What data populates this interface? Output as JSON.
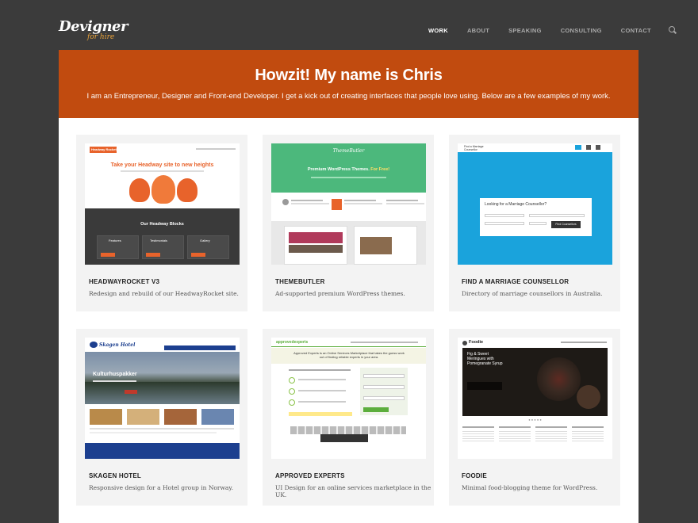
{
  "header": {
    "logo_main": "Devigner",
    "logo_sub": "for hire",
    "nav": [
      "WORK",
      "ABOUT",
      "SPEAKING",
      "CONSULTING",
      "CONTACT"
    ],
    "active_nav": "WORK"
  },
  "hero": {
    "title": "Howzit! My name is Chris",
    "subtitle": "I am an Entrepreneur, Designer and Front-end Developer. I get a kick out of creating interfaces that people love using. Below are a few examples of my work."
  },
  "projects": [
    {
      "title": "HEADWAYROCKET V3",
      "desc": "Redesign and rebuild of our HeadwayRocket site.",
      "thumb": {
        "headline": "Take your Headway site to new heights",
        "section": "Our Headway Blocks",
        "cols": [
          "Features",
          "Testimonials",
          "Gallery"
        ],
        "brand": "Headway Rocket"
      }
    },
    {
      "title": "THEMEBUTLER",
      "desc": "Ad-supported premium WordPress themes.",
      "thumb": {
        "brand": "ThemeButler",
        "headline": "Premium WordPress Themes.",
        "highlight": "For Free!"
      }
    },
    {
      "title": "FIND A MARRIAGE COUNSELLOR",
      "desc": "Directory of marriage counsellors in Australia.",
      "thumb": {
        "brand": "Find a Marriage Counsellor",
        "question": "Looking for a Marriage Counsellor?",
        "button": "Find Counsellors"
      }
    },
    {
      "title": "SKAGEN HOTEL",
      "desc": "Responsive design for a Hotel group in Norway.",
      "thumb": {
        "brand": "Skagen Hotel",
        "banner": "Kulturhuspakker"
      }
    },
    {
      "title": "APPROVED EXPERTS",
      "desc": "UI Design for an online services marketplace in the UK.",
      "thumb": {
        "brand": "approvedexperts",
        "headline": "Approved Experts is an Online Services Marketplace that takes the guess work out of finding reliable experts in your area."
      }
    },
    {
      "title": "FOODIE",
      "desc": "Minimal food-blogging theme for WordPress.",
      "thumb": {
        "brand": "Foodie",
        "headline": "Fig & Sweet Meringues with Pomegranate Syrup"
      }
    }
  ],
  "colors": {
    "hero": "#c14b0f",
    "page_bg": "#3b3b3b",
    "card_bg": "#f3f3f3",
    "logo_accent": "#e8a23a"
  }
}
